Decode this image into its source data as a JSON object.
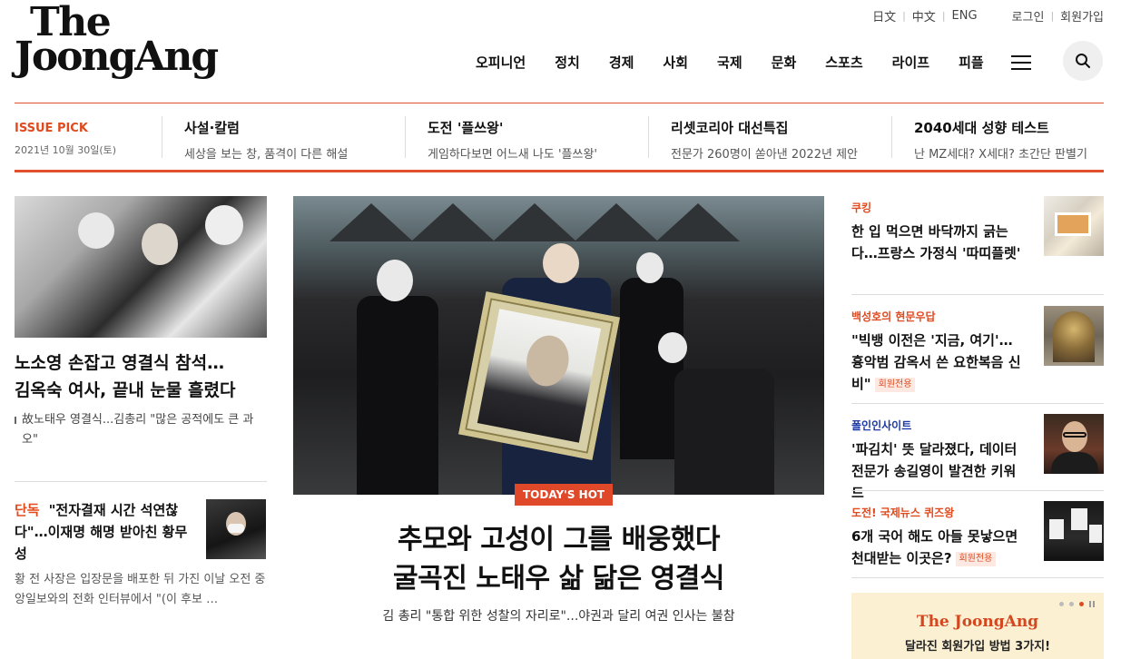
{
  "logo": {
    "line1": "The",
    "line2": "JoongAng"
  },
  "util_nav": {
    "langs": [
      "日文",
      "中文",
      "ENG"
    ],
    "login": "로그인",
    "signup": "회원가입"
  },
  "gnb": {
    "items": [
      "오피니언",
      "정치",
      "경제",
      "사회",
      "국제",
      "문화",
      "스포츠",
      "라이프",
      "피플"
    ],
    "menu_icon": "hamburger-icon",
    "search_icon": "search-icon"
  },
  "issue_bar": {
    "pick_label": "ISSUE PICK",
    "date": "2021년 10월 30일(토)",
    "items": [
      {
        "title": "사설·칼럼",
        "sub": "세상을 보는 창, 품격이 다른 해설"
      },
      {
        "title": "도전 '플쓰왕'",
        "sub": "게임하다보면 어느새 나도 '플쓰왕'"
      },
      {
        "title": "리셋코리아 대선특집",
        "sub": "전문가 260명이 쏟아낸 2022년 제안"
      },
      {
        "title": "2040세대 성향 테스트",
        "sub": "난 MZ세대? X세대? 초간단 판별기"
      }
    ]
  },
  "left": {
    "headline_line1": "노소영 손잡고 영결식 참석…",
    "headline_line2": "김옥숙 여사, 끝내 눈물 흘렸다",
    "sub": "故노태우 영결식...김총리 \"많은 공적에도 큰 과오\"",
    "exclusive": {
      "tag": "단독",
      "title": "\"전자결재 시간 석연찮다\"…이재명 해명 받아친 황무성",
      "summary": "황 전 사장은 입장문을 배포한 뒤 가진 이날 오전 중앙일보와의 전화 인터뷰에서 \"(이 후보 …"
    }
  },
  "center": {
    "badge": "TODAY'S HOT",
    "headline_line1": "추모와 고성이 그를 배웅했다",
    "headline_line2": "굴곡진 노태우 삶 닮은 영결식",
    "sub": "김 총리 \"통합 위한 성찰의 자리로\"...야권과 달리 여권 인사는 불참"
  },
  "right": {
    "items": [
      {
        "label": "쿠킹",
        "title": "한 입 먹으면 바닥까지 긁는다…프랑스 가정식 '따띠플렛'",
        "badge": ""
      },
      {
        "label": "백성호의 현문우답",
        "title": "\"빅뱅 이전은 '지금, 여기'… 흉악범 감옥서 쓴 요한복음 신비\"",
        "badge": "회원전용"
      },
      {
        "label": "폴인인사이트",
        "title": "'파김치' 뜻 달라졌다, 데이터 전문가 송길영이 발견한 키워드",
        "badge": ""
      },
      {
        "label": "도전! 국제뉴스 퀴즈왕",
        "title": "6개 국어 해도 아들 못낳으면 천대받는 이곳은?",
        "badge": "회원전용"
      }
    ],
    "promo": {
      "brand": "The JoongAng",
      "text": "달라진 회원가입 방법 3가지!"
    }
  },
  "colors": {
    "accent": "#e0502a",
    "label_blue": "#1d3aa8"
  }
}
